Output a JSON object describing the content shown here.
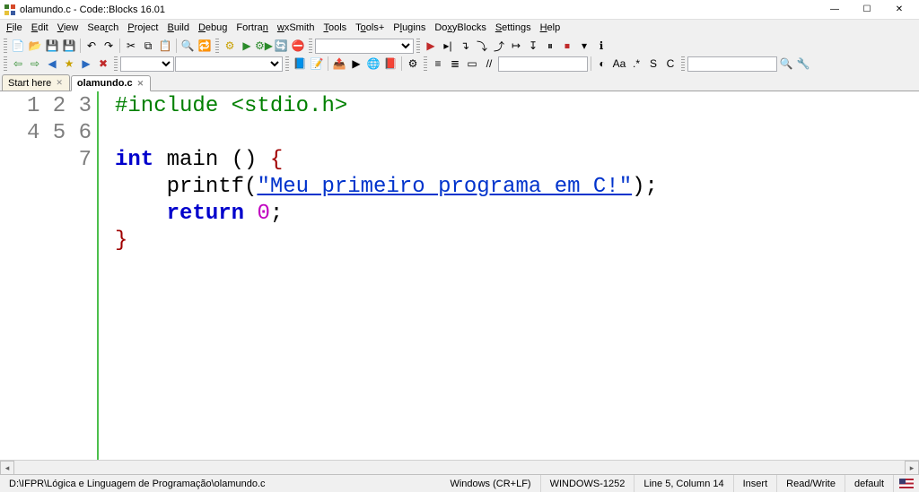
{
  "title": "olamundo.c - Code::Blocks 16.01",
  "menu": [
    "File",
    "Edit",
    "View",
    "Search",
    "Project",
    "Build",
    "Debug",
    "Fortran",
    "wxSmith",
    "Tools",
    "Tools+",
    "Plugins",
    "DoxyBlocks",
    "Settings",
    "Help"
  ],
  "tabs": [
    {
      "label": "Start here",
      "active": false
    },
    {
      "label": "olamundo.c",
      "active": true
    }
  ],
  "gutter": [
    "1",
    "2",
    "3",
    "4",
    "5",
    "6",
    "7"
  ],
  "code": {
    "l1_pp": "#include <stdio.h>",
    "l3_kw": "int",
    "l3_rest": " main () ",
    "l3_brace": "{",
    "l4_indent": "    ",
    "l4_fn": "printf",
    "l4_open": "(",
    "l4_str": "\"Meu primeiro programa em C!\"",
    "l4_close": ")",
    "l4_semi": ";",
    "l5_indent": "    ",
    "l5_kw": "return",
    "l5_sp": " ",
    "l5_num": "0",
    "l5_semi": ";",
    "l6_brace": "}"
  },
  "status": {
    "path": "D:\\IFPR\\Lógica e Linguagem de Programação\\olamundo.c",
    "eol": "Windows (CR+LF)",
    "encoding": "WINDOWS-1252",
    "pos": "Line 5, Column 14",
    "insert": "Insert",
    "rw": "Read/Write",
    "scheme": "default"
  },
  "win": {
    "min": "—",
    "max": "☐",
    "close": "✕"
  }
}
